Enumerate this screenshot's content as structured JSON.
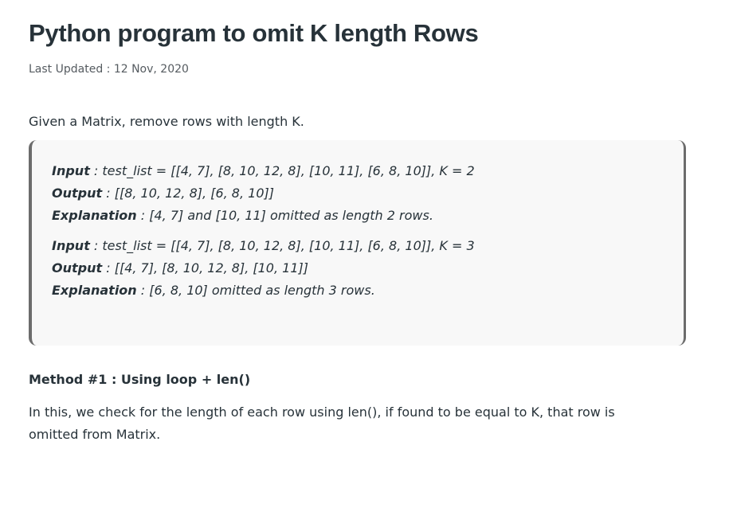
{
  "article": {
    "title": "Python program to omit K length Rows",
    "last_updated": "Last Updated : 12 Nov, 2020",
    "intro": "Given a Matrix, remove rows with length K."
  },
  "examples": [
    {
      "input_label": "Input",
      "input_text": " : test_list = [[4, 7], [8, 10, 12, 8], [10, 11], [6, 8, 10]], K = 2",
      "output_label": "Output",
      "output_text": " : [[8, 10, 12, 8], [6, 8, 10]]",
      "explanation_label": "Explanation",
      "explanation_text": " : [4, 7] and [10, 11] omitted as length 2 rows."
    },
    {
      "input_label": "Input",
      "input_text": " : test_list = [[4, 7], [8, 10, 12, 8], [10, 11], [6, 8, 10]], K = 3",
      "output_label": "Output",
      "output_text": " : [[4, 7], [8, 10, 12, 8], [10, 11]]",
      "explanation_label": "Explanation",
      "explanation_text": " : [6, 8, 10] omitted as length 3 rows."
    }
  ],
  "method": {
    "heading": "Method #1 :  Using loop + len()",
    "description": "In this, we check for the length of each row using len(), if found to be equal to K, that row is omitted from Matrix."
  }
}
